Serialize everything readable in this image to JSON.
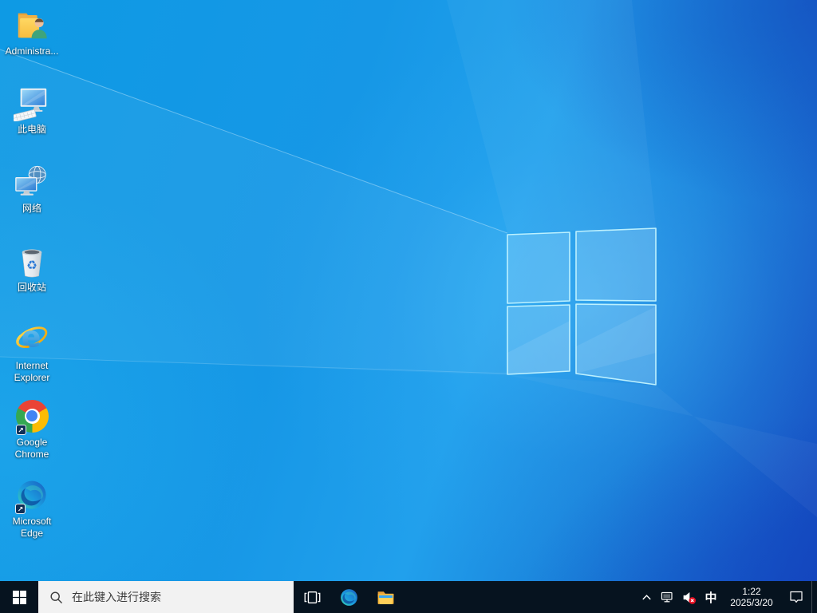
{
  "desktop": {
    "shortcut_arrow": "↗",
    "recycle_glyph": "♻",
    "icons": [
      {
        "id": "administrator",
        "icon": "user-folder-icon",
        "label": "Administra..."
      },
      {
        "id": "this-pc",
        "icon": "computer-icon",
        "label": "此电脑"
      },
      {
        "id": "network",
        "icon": "network-globe-icon",
        "label": "网络"
      },
      {
        "id": "recycle-bin",
        "icon": "recycle-bin-icon",
        "label": "回收站"
      },
      {
        "id": "internet-explorer",
        "icon": "ie-icon",
        "label": "Internet Explorer"
      },
      {
        "id": "google-chrome",
        "icon": "chrome-icon",
        "label": "Google Chrome"
      },
      {
        "id": "microsoft-edge",
        "icon": "edge-icon",
        "label": "Microsoft Edge"
      }
    ]
  },
  "taskbar": {
    "search_placeholder": "在此键入进行搜索",
    "buttons": [
      {
        "id": "start",
        "icon": "windows-start-icon"
      },
      {
        "id": "task-view",
        "icon": "task-view-icon"
      },
      {
        "id": "edge",
        "icon": "edge-icon"
      },
      {
        "id": "file-explorer",
        "icon": "folder-icon"
      }
    ],
    "tray": {
      "expand": {
        "icon": "chevron-up-icon"
      },
      "network": {
        "icon": "ethernet-icon"
      },
      "volume": {
        "icon": "speaker-muted-icon",
        "status": "error"
      },
      "ime_label": "中",
      "clock": {
        "time": "1:22",
        "date": "2025/3/20"
      },
      "action_center": {
        "icon": "notification-bubble-icon"
      }
    }
  },
  "colors": {
    "taskbar_bg": "#06131f",
    "search_bg": "#f2f2f2",
    "wallpaper_bright": "#21a0ec",
    "wallpaper_deep": "#1546bd",
    "logo_edge": "#c3f4ff",
    "volume_error": "#e81123"
  }
}
